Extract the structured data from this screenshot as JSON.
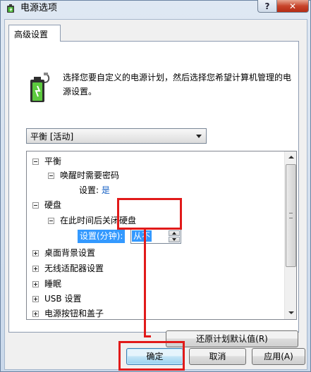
{
  "window": {
    "title": "电源选项",
    "help_label": "?",
    "close_label": "✕"
  },
  "tab": {
    "label": "高级设置"
  },
  "description": "选择您要自定义的电源计划，然后选择您希望计算机管理的电源设置。",
  "plan_select": {
    "value": "平衡 [活动]"
  },
  "tree": {
    "items": [
      {
        "label": "平衡",
        "expanded": true
      },
      {
        "label": "唤醒时需要密码",
        "expanded": true
      },
      {
        "setting_label": "设置:",
        "setting_value": "是"
      },
      {
        "label": "硬盘",
        "expanded": true
      },
      {
        "label": "在此时间后关闭硬盘",
        "expanded": true
      },
      {
        "setting_label": "设置(分钟):",
        "setting_value": "从不"
      },
      {
        "label": "桌面背景设置",
        "expanded": false
      },
      {
        "label": "无线适配器设置",
        "expanded": false
      },
      {
        "label": "睡眠",
        "expanded": false
      },
      {
        "label": "USB 设置",
        "expanded": false
      },
      {
        "label": "电源按钮和盖子",
        "expanded": false
      }
    ]
  },
  "buttons": {
    "restore": "还原计划默认值(R)",
    "ok": "确定",
    "cancel": "取消",
    "apply": "应用(A)"
  },
  "colors": {
    "annotation_red": "#e11a1a",
    "selection_blue": "#3399ff",
    "link_blue": "#1560c4"
  }
}
